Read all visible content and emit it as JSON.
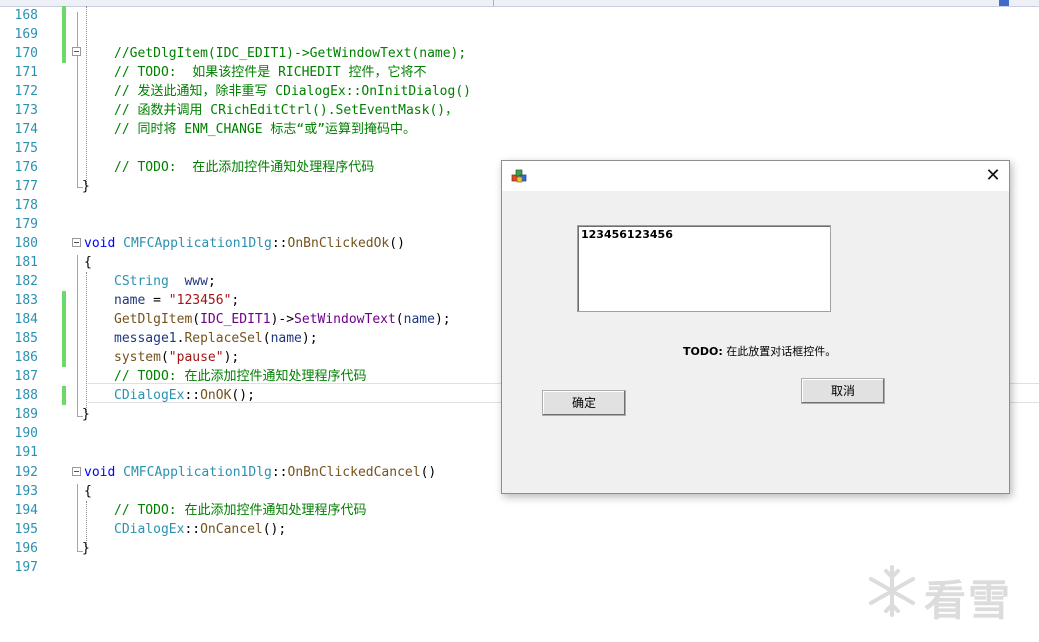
{
  "editor": {
    "lines": [
      {
        "n": "168",
        "text": ""
      },
      {
        "n": "169",
        "text": ""
      },
      {
        "n": "170",
        "text": "//GetDlgItem(IDC_EDIT1)->GetWindowText(name);"
      },
      {
        "n": "171",
        "text": "// TODO:  如果该控件是 RICHEDIT 控件，它将不"
      },
      {
        "n": "172",
        "text": "// 发送此通知，除非重写 CDialogEx::OnInitDialog()"
      },
      {
        "n": "173",
        "text": "// 函数并调用 CRichEditCtrl().SetEventMask()，"
      },
      {
        "n": "174",
        "text": "// 同时将 ENM_CHANGE 标志“或”运算到掩码中。"
      },
      {
        "n": "175",
        "text": ""
      },
      {
        "n": "176",
        "text": "// TODO:  在此添加控件通知处理程序代码"
      },
      {
        "n": "177",
        "text": "}"
      },
      {
        "n": "178",
        "text": ""
      },
      {
        "n": "179",
        "text": ""
      },
      {
        "n": "180",
        "text": "void CMFCApplication1Dlg::OnBnClickedOk()"
      },
      {
        "n": "181",
        "text": "{"
      },
      {
        "n": "182",
        "text": "CString  www;"
      },
      {
        "n": "183",
        "text": "name = \"123456\";"
      },
      {
        "n": "184",
        "text": "GetDlgItem(IDC_EDIT1)->SetWindowText(name);"
      },
      {
        "n": "185",
        "text": "message1.ReplaceSel(name);"
      },
      {
        "n": "186",
        "text": "system(\"pause\");"
      },
      {
        "n": "187",
        "text": "// TODO: 在此添加控件通知处理程序代码"
      },
      {
        "n": "188",
        "text": "CDialogEx::OnOK();"
      },
      {
        "n": "189",
        "text": "}"
      },
      {
        "n": "190",
        "text": ""
      },
      {
        "n": "191",
        "text": ""
      },
      {
        "n": "192",
        "text": "void CMFCApplication1Dlg::OnBnClickedCancel()"
      },
      {
        "n": "193",
        "text": "{"
      },
      {
        "n": "194",
        "text": "// TODO: 在此添加控件通知处理程序代码"
      },
      {
        "n": "195",
        "text": "CDialogEx::OnCancel();"
      },
      {
        "n": "196",
        "text": "}"
      },
      {
        "n": "197",
        "text": ""
      }
    ],
    "colors": {
      "line_number": "#2b91af",
      "keyword": "#0000ff",
      "comment": "#008000",
      "string": "#a31515",
      "function": "#74531f",
      "macro": "#6f008a",
      "change_marker": "#6bd86b"
    }
  },
  "dialog": {
    "icon": "mfc-app-icon",
    "close_label": "✕",
    "edit_value": "123456123456",
    "todo_bold": "TODO:",
    "todo_text": " 在此放置对话框控件。",
    "ok_label": "确定",
    "cancel_label": "取消"
  },
  "watermark": {
    "icon": "snowflake-icon",
    "text": "看雪"
  }
}
